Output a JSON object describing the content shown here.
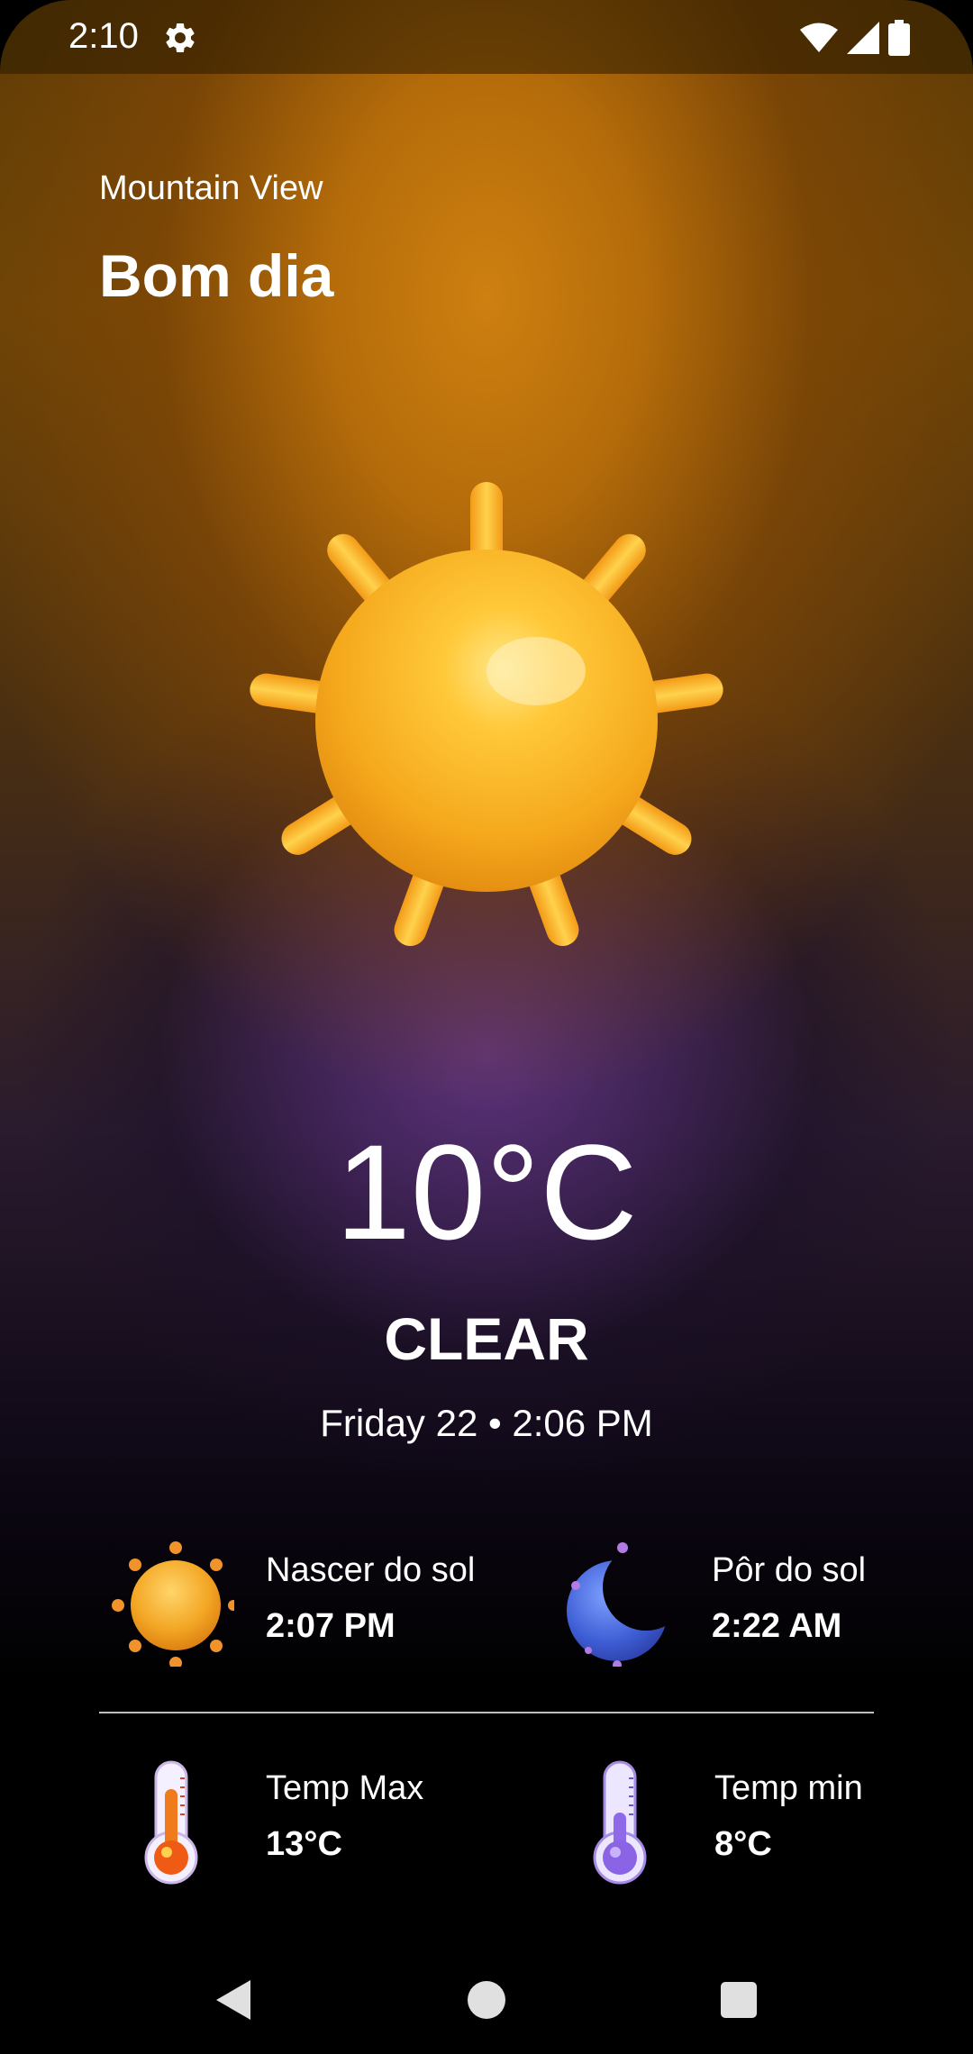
{
  "status_bar": {
    "time": "2:10",
    "icons": [
      "settings-icon",
      "wifi-icon",
      "signal-icon",
      "battery-icon"
    ]
  },
  "header": {
    "location": "Mountain View",
    "greeting": "Bom dia"
  },
  "weather": {
    "icon": "sun-icon",
    "temperature": "10°C",
    "condition": "CLEAR",
    "datetime": "Friday 22 • 2:06 PM"
  },
  "details": {
    "sunrise": {
      "label": "Nascer do sol",
      "value": "2:07 PM",
      "icon": "sunrise-icon"
    },
    "sunset": {
      "label": "Pôr do sol",
      "value": "2:22 AM",
      "icon": "moon-icon"
    },
    "temp_max": {
      "label": "Temp Max",
      "value": "13°C",
      "icon": "thermometer-hot-icon"
    },
    "temp_min": {
      "label": "Temp min",
      "value": "8°C",
      "icon": "thermometer-cold-icon"
    }
  },
  "nav_bar": {
    "buttons": [
      "back-icon",
      "home-icon",
      "recents-icon"
    ]
  },
  "colors": {
    "sun": "#f7b21c",
    "background_top": "#c47d10",
    "background_mid": "#5c3478",
    "background_bottom": "#000000",
    "text": "#ffffff"
  }
}
